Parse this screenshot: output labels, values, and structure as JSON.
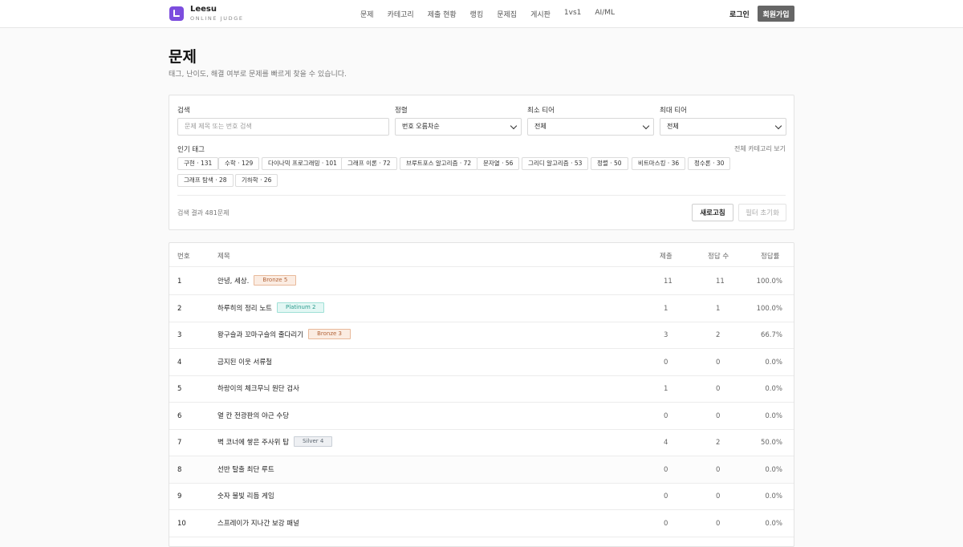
{
  "brand": {
    "name": "Leesu",
    "sub": "ONLINE JUDGE"
  },
  "nav": [
    "문제",
    "카테고리",
    "제출 현황",
    "랭킹",
    "문제집",
    "게시판",
    "1vs1",
    "AI/ML"
  ],
  "auth": {
    "login": "로그인",
    "signup": "회원가입"
  },
  "page": {
    "title": "문제",
    "subtitle": "태그, 난이도, 해결 여부로 문제를 빠르게 찾을 수 있습니다."
  },
  "filter": {
    "search_label": "검색",
    "search_placeholder": "문제 제목 또는 번호 검색",
    "sort_label": "정렬",
    "sort_value": "번호 오름차순",
    "min_tier_label": "최소 티어",
    "min_tier_value": "전체",
    "max_tier_label": "최대 티어",
    "max_tier_value": "전체",
    "tags_label": "인기 태그",
    "all_categories": "전체 카테고리 보기",
    "tags": [
      "구현 · 131",
      "수학 · 129",
      "다이나믹 프로그래밍 · 101",
      "그래프 이론 · 72",
      "브루트포스 알고리즘 · 72",
      "문자열 · 56",
      "그리디 알고리즘 · 53",
      "정렬 · 50",
      "비트마스킹 · 36",
      "정수론 · 30",
      "그래프 탐색 · 28",
      "기하학 · 26"
    ],
    "result_count": "검색 결과 481문제",
    "refresh": "새로고침",
    "reset": "필터 초기화"
  },
  "table": {
    "headers": {
      "id": "번호",
      "title": "제목",
      "submissions": "제출",
      "solved": "정답 수",
      "rate": "정답률"
    },
    "rows": [
      {
        "id": "1",
        "title": "안녕, 세상.",
        "badge": "Bronze 5",
        "submissions": "11",
        "solved": "11",
        "rate": "100.0%"
      },
      {
        "id": "2",
        "title": "하루히의 정리 노트",
        "badge": "Platinum 2",
        "submissions": "1",
        "solved": "1",
        "rate": "100.0%"
      },
      {
        "id": "3",
        "title": "왕구슬과 꼬마구슬의 줄다리기",
        "badge": "Bronze 3",
        "submissions": "3",
        "solved": "2",
        "rate": "66.7%"
      },
      {
        "id": "4",
        "title": "금지된 이웃 서류철",
        "badge": "",
        "submissions": "0",
        "solved": "0",
        "rate": "0.0%"
      },
      {
        "id": "5",
        "title": "하랑이의 체크무늬 원단 검사",
        "badge": "",
        "submissions": "1",
        "solved": "0",
        "rate": "0.0%"
      },
      {
        "id": "6",
        "title": "열 칸 전광판의 야근 수당",
        "badge": "",
        "submissions": "0",
        "solved": "0",
        "rate": "0.0%"
      },
      {
        "id": "7",
        "title": "벽 코너에 쌓은 주사위 탑",
        "badge": "Silver 4",
        "submissions": "4",
        "solved": "2",
        "rate": "50.0%"
      },
      {
        "id": "8",
        "title": "선반 탈출 최단 루트",
        "badge": "",
        "submissions": "0",
        "solved": "0",
        "rate": "0.0%"
      },
      {
        "id": "9",
        "title": "숫자 불빛 리듬 게임",
        "badge": "",
        "submissions": "0",
        "solved": "0",
        "rate": "0.0%"
      },
      {
        "id": "10",
        "title": "스프레이가 지나간 보강 패널",
        "badge": "",
        "submissions": "0",
        "solved": "0",
        "rate": "0.0%"
      }
    ]
  },
  "badge_colors": {
    "Bronze": {
      "bg": "#fbece2",
      "border": "#e8b99a",
      "text": "#b2643a"
    },
    "Silver": {
      "bg": "#eef0f3",
      "border": "#c9cfd6",
      "text": "#5d6670"
    },
    "Platinum": {
      "bg": "#e3f7f4",
      "border": "#9fe0d6",
      "text": "#2a9b8d"
    }
  }
}
